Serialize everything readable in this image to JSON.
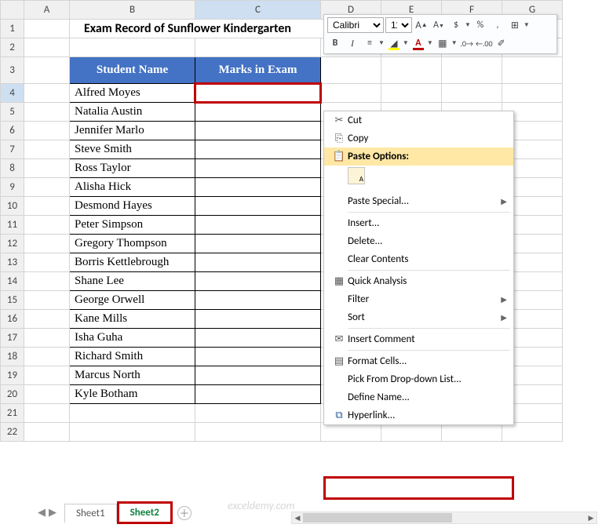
{
  "columns": [
    "A",
    "B",
    "C",
    "D",
    "E",
    "F",
    "G"
  ],
  "rows": [
    1,
    2,
    3,
    4,
    5,
    6,
    7,
    8,
    9,
    10,
    11,
    12,
    13,
    14,
    15,
    16,
    17,
    18,
    19,
    20,
    21,
    22
  ],
  "active_row": 4,
  "active_col": "C",
  "title": "Exam Record of Sunflower Kindergarten",
  "table_headers": {
    "b": "Student Name",
    "c": "Marks in Exam"
  },
  "students": [
    "Alfred Moyes",
    "Natalia Austin",
    "Jennifer Marlo",
    "Steve Smith",
    "Ross Taylor",
    "Alisha Hick",
    "Desmond Hayes",
    "Peter Simpson",
    "Gregory Thompson",
    "Borris Kettlebrough",
    "Shane Lee",
    "George Orwell",
    "Kane Mills",
    "Isha Guha",
    "Richard Smith",
    "Marcus North",
    "Kyle Botham"
  ],
  "mini_toolbar": {
    "font_name": "Calibri",
    "font_size": "11",
    "row1_btns": {
      "grow": "A",
      "shrink": "A",
      "dollar": "$",
      "percent": "%",
      "comma": ",",
      "merge": "▦"
    },
    "row2_btns": {
      "bold": "B",
      "italic": "I",
      "align": "≡",
      "fill_color": "#ffff00",
      "font_color": "#c00000",
      "borders": "▦",
      "inc_dec": ".0",
      "dec_dec": ".00",
      "painter": "🖌"
    }
  },
  "context": {
    "cut": "Cut",
    "copy": "Copy",
    "paste_options": "Paste Options:",
    "paste_special": "Paste Special...",
    "insert": "Insert...",
    "delete": "Delete...",
    "clear": "Clear Contents",
    "quick": "Quick Analysis",
    "filter": "Filter",
    "sort": "Sort",
    "insert_comment": "Insert Comment",
    "format_cells": "Format Cells...",
    "pick_list": "Pick From Drop-down List...",
    "define_name": "Define Name...",
    "hyperlink": "Hyperlink..."
  },
  "sheets": {
    "s1": "Sheet1",
    "s2": "Sheet2"
  },
  "watermark": "exceldemy.com"
}
